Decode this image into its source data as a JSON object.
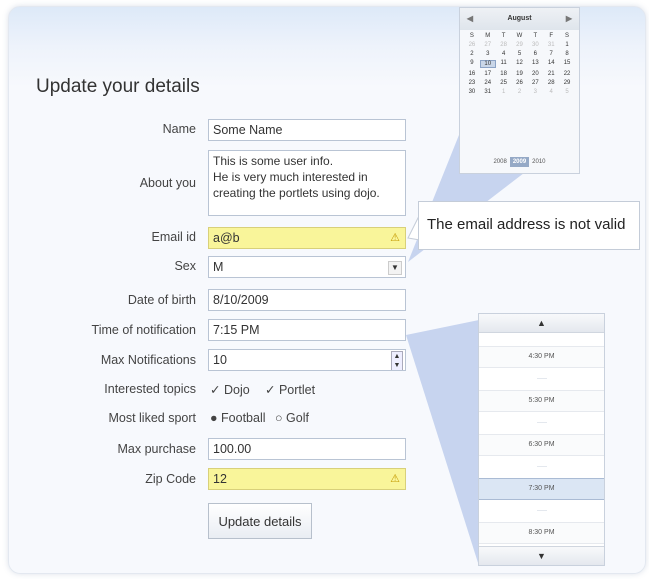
{
  "page_title": "Update your details",
  "labels": {
    "name": "Name",
    "about": "About you",
    "email": "Email id",
    "sex": "Sex",
    "dob": "Date of birth",
    "time": "Time of notification",
    "max_notifications": "Max Notifications",
    "topics": "Interested topics",
    "sport": "Most liked sport",
    "max_purchase": "Max purchase",
    "zip": "Zip Code"
  },
  "values": {
    "name": "Some Name",
    "about_lines": [
      "This is some user info.",
      "He is very much interested in",
      "creating the portlets using dojo."
    ],
    "email": "a@b",
    "sex": "M",
    "dob": "8/10/2009",
    "time": "7:15 PM",
    "max_notifications": "10",
    "max_purchase": "100.00",
    "zip": "12"
  },
  "topics": [
    {
      "label": "Dojo",
      "checked": true
    },
    {
      "label": "Portlet",
      "checked": true
    }
  ],
  "sports": [
    {
      "label": "Football",
      "selected": true
    },
    {
      "label": "Golf",
      "selected": false
    }
  ],
  "submit_label": "Update details",
  "tooltip": "The email address is not valid",
  "calendar": {
    "month": "August",
    "weekdays": [
      "S",
      "M",
      "T",
      "W",
      "T",
      "F",
      "S"
    ],
    "weeks": [
      [
        {
          "d": "26",
          "dim": true
        },
        {
          "d": "27",
          "dim": true
        },
        {
          "d": "28",
          "dim": true
        },
        {
          "d": "29",
          "dim": true
        },
        {
          "d": "30",
          "dim": true
        },
        {
          "d": "31",
          "dim": true
        },
        {
          "d": "1"
        }
      ],
      [
        {
          "d": "2"
        },
        {
          "d": "3"
        },
        {
          "d": "4"
        },
        {
          "d": "5"
        },
        {
          "d": "6"
        },
        {
          "d": "7"
        },
        {
          "d": "8"
        }
      ],
      [
        {
          "d": "9"
        },
        {
          "d": "10",
          "sel": true
        },
        {
          "d": "11"
        },
        {
          "d": "12"
        },
        {
          "d": "13"
        },
        {
          "d": "14"
        },
        {
          "d": "15"
        }
      ],
      [
        {
          "d": "16"
        },
        {
          "d": "17"
        },
        {
          "d": "18"
        },
        {
          "d": "19"
        },
        {
          "d": "20"
        },
        {
          "d": "21"
        },
        {
          "d": "22"
        }
      ],
      [
        {
          "d": "23"
        },
        {
          "d": "24"
        },
        {
          "d": "25"
        },
        {
          "d": "26"
        },
        {
          "d": "27"
        },
        {
          "d": "28"
        },
        {
          "d": "29"
        }
      ],
      [
        {
          "d": "30"
        },
        {
          "d": "31"
        },
        {
          "d": "1",
          "dim": true
        },
        {
          "d": "2",
          "dim": true
        },
        {
          "d": "3",
          "dim": true
        },
        {
          "d": "4",
          "dim": true
        },
        {
          "d": "5",
          "dim": true
        }
      ]
    ],
    "years": [
      "2008",
      "2009",
      "2010"
    ],
    "current_year": "2009"
  },
  "time_picker": {
    "times": [
      "4:30 PM",
      "5:30 PM",
      "6:30 PM",
      "7:30 PM",
      "8:30 PM"
    ],
    "selected": "7:30 PM"
  },
  "colors": {
    "error_field": "#f9f59a",
    "panel_top": "#dde9f8",
    "selected_year": "#95a9c6"
  }
}
